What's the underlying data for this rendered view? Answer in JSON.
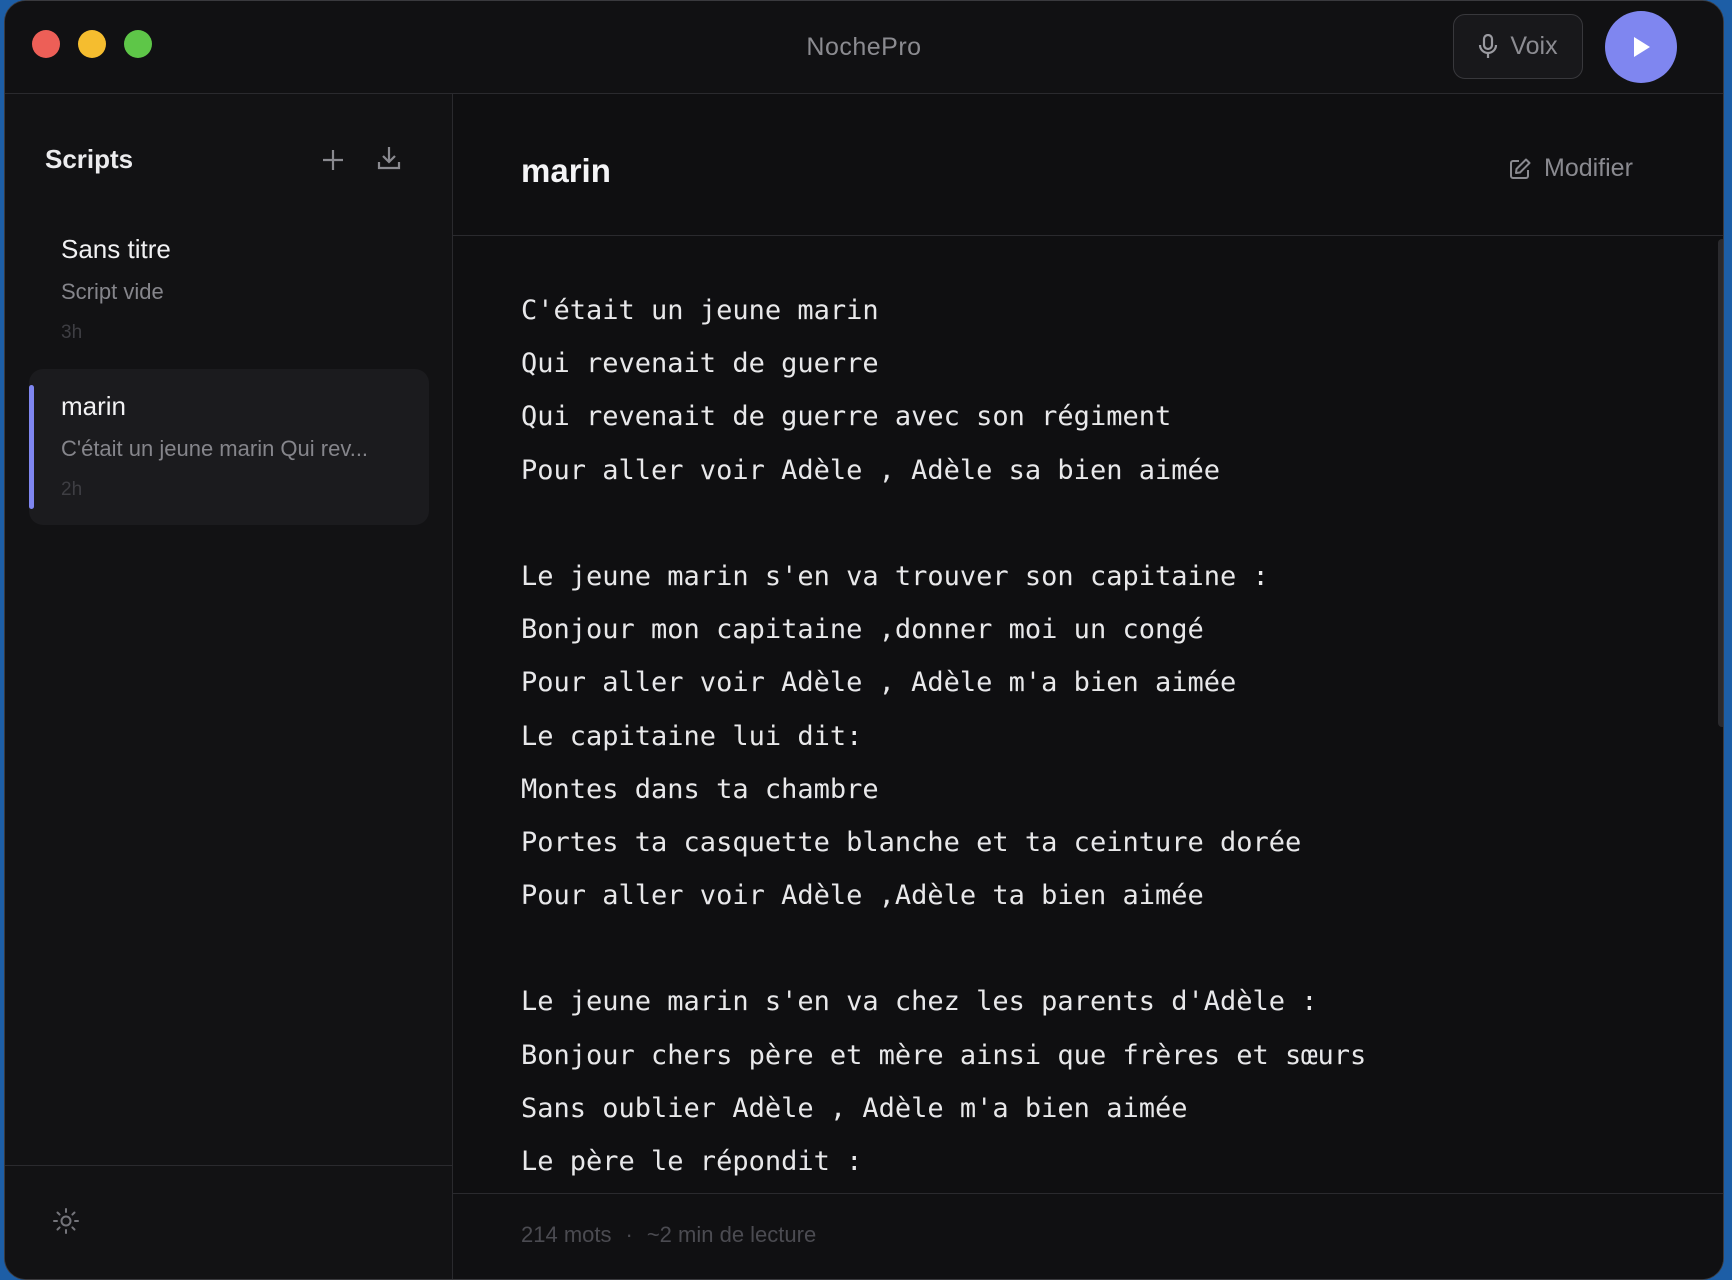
{
  "app": {
    "title": "NochePro"
  },
  "titlebar": {
    "voice_label": "Voix"
  },
  "sidebar": {
    "heading": "Scripts",
    "items": [
      {
        "title": "Sans titre",
        "preview": "Script vide",
        "time": "3h",
        "active": false
      },
      {
        "title": "marin",
        "preview": "C'était un jeune marin Qui rev...",
        "time": "2h",
        "active": true
      }
    ]
  },
  "document": {
    "title": "marin",
    "edit_label": "Modifier",
    "lines": [
      "C'était un jeune marin",
      "Qui revenait de guerre",
      "Qui revenait de guerre avec son régiment",
      "Pour aller voir Adèle , Adèle sa bien aimée",
      "",
      "Le jeune marin s'en va trouver son capitaine :",
      "Bonjour mon capitaine ,donner moi un congé",
      "Pour aller voir Adèle , Adèle m'a bien aimée",
      "Le capitaine lui dit:",
      "Montes dans ta chambre",
      "Portes ta casquette blanche et ta ceinture dorée",
      "Pour aller voir Adèle ,Adèle ta bien aimée",
      "",
      "Le jeune marin s'en va chez les parents d'Adèle :",
      "Bonjour chers père et mère ainsi que frères et sœurs",
      "Sans oublier Adèle , Adèle m'a bien aimée",
      "Le père le répondit :"
    ]
  },
  "footer": {
    "words": "214 mots",
    "separator": "·",
    "reading_time": "~2 min de lecture"
  },
  "colors": {
    "accent": "#7f86f0",
    "background": "#101012"
  },
  "icons": [
    "microphone-icon",
    "play-icon",
    "plus-icon",
    "download-icon",
    "edit-icon",
    "settings-icon"
  ]
}
